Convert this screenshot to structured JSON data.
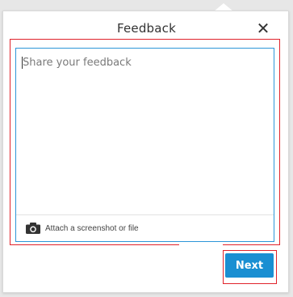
{
  "dialog": {
    "title": "Feedback",
    "close_icon": "close-icon"
  },
  "feedback": {
    "placeholder": "Share your feedback",
    "value": ""
  },
  "attach": {
    "icon": "camera-icon",
    "label": "Attach a screenshot or file"
  },
  "actions": {
    "next_label": "Next"
  },
  "colors": {
    "accent": "#1a8fd2",
    "focus_border": "#2d96d8",
    "highlight_frame": "#e0232b"
  }
}
